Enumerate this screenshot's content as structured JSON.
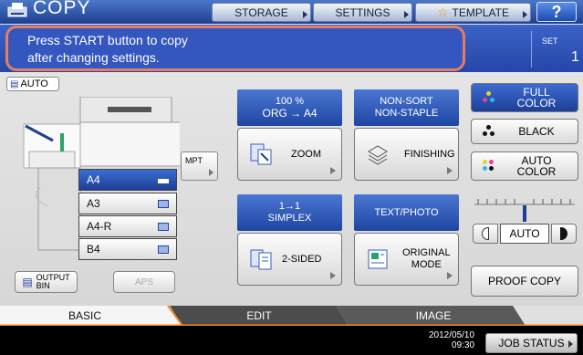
{
  "header": {
    "title": "COPY",
    "storage_label": "STORAGE",
    "settings_label": "SETTINGS",
    "template_label": "TEMPLATE",
    "help_label": "?"
  },
  "message": {
    "line1": "Press START button to copy",
    "line2": "after changing settings.",
    "set_label": "SET",
    "set_value": "1"
  },
  "left": {
    "auto_label": "AUTO",
    "trays": [
      "A4",
      "A3",
      "A4-R",
      "B4"
    ],
    "selected_tray": "A4",
    "mpt_label": "MPT",
    "output_bin_label": "OUTPUT\nBIN",
    "aps_label": "APS"
  },
  "functions": {
    "zoom": {
      "line1": "100 %",
      "line2": "ORG  →  A4",
      "button": "ZOOM"
    },
    "finishing": {
      "line1": "NON-SORT",
      "line2": "NON-STAPLE",
      "button": "FINISHING"
    },
    "sided": {
      "line1": "1→1",
      "line2": "SIMPLEX",
      "button": "2-SIDED"
    },
    "original": {
      "line1": "TEXT/PHOTO",
      "button_line1": "ORIGINAL",
      "button_line2": "MODE"
    }
  },
  "color": {
    "full": {
      "line1": "FULL",
      "line2": "COLOR"
    },
    "black": "BLACK",
    "auto": {
      "line1": "AUTO",
      "line2": "COLOR"
    },
    "selected": "FULL COLOR"
  },
  "density": {
    "auto_label": "AUTO",
    "level_fraction": 0.5
  },
  "proof_copy_label": "PROOF COPY",
  "tabs": [
    "BASIC",
    "EDIT",
    "IMAGE"
  ],
  "active_tab": "BASIC",
  "status": {
    "date": "2012/05/10",
    "time": "09:30",
    "job_status_label": "JOB STATUS"
  },
  "colors": {
    "accent_blue": "#2646a8",
    "tab_orange": "#f08a2c",
    "highlight": "#e37e61"
  }
}
